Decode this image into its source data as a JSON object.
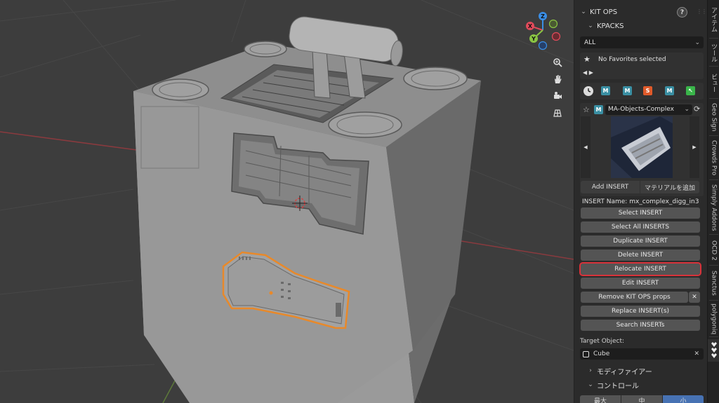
{
  "panel": {
    "kitops_title": "KIT OPS",
    "kpacks_title": "KPACKS",
    "filter_value": "ALL",
    "favorites_text": "No Favorites selected",
    "kpack_name": "MA-Objects-Complex",
    "add_insert": "Add INSERT",
    "add_material": "マテリアルを追加",
    "insert_name_label": "INSERT Name: mx_complex_digg_in3",
    "buttons": {
      "select_insert": "Select INSERT",
      "select_all": "Select All INSERTS",
      "duplicate": "Duplicate INSERT",
      "delete": "Delete INSERT",
      "relocate": "Relocate INSERT",
      "edit": "Edit INSERT",
      "remove_props": "Remove KIT OPS props",
      "replace": "Replace INSERT(s)",
      "search": "Search INSERTs"
    },
    "target_label": "Target Object:",
    "target_value": "Cube",
    "modifier_label": "モディファイアー",
    "control_label": "コントロール",
    "size_max": "最大",
    "size_mid": "中",
    "size_small": "小"
  },
  "tabs": [
    "アイテム",
    "ツール",
    "ビュー",
    "Geo Sign",
    "Crowds Pro",
    "Simply Addons",
    "OCD 2",
    "Sanctus",
    "polygoniq"
  ],
  "gizmo": {
    "x": "X",
    "y": "Y",
    "z": "Z"
  },
  "colors": {
    "accent_red": "#d8323a",
    "selection_orange": "#e8892a",
    "axis_x": "#e14b5b",
    "axis_y": "#8ac543",
    "axis_z": "#3a8ee6"
  }
}
